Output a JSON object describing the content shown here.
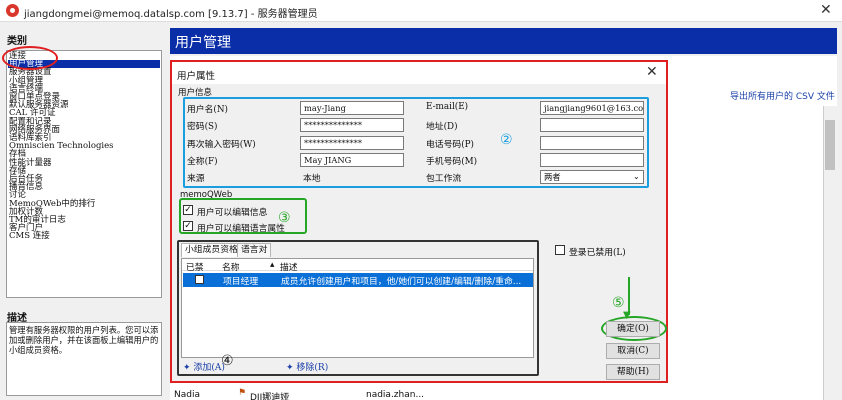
{
  "window": {
    "title": "jiangdongmei@memoq.datalsp.com [9.13.7] - 服务器管理员"
  },
  "left": {
    "category_heading": "类别",
    "categories": [
      "连接",
      "用户管理",
      "服务器设置",
      "小组管理",
      "语言终端",
      "窗口单点登录",
      "默认服务器资源",
      "CAL 许可证",
      "配置和记录",
      "网络服务界面",
      "语料库索引",
      "Omniscien Technologies",
      "存档",
      "性能计量器",
      "存储",
      "后台任务",
      "播音信息",
      "讨论",
      "MemoQWeb中的排行",
      "加权计数",
      "TM的审计日志",
      "客户门户",
      "CMS 连接"
    ],
    "selected_index": 1,
    "description_heading": "描述",
    "description": "管理有服务器权限的用户列表。您可以添加或删除用户，并在该面板上编辑用户的小组成员资格。"
  },
  "main": {
    "title": "用户管理",
    "csv_link": "导出所有用户的 CSV 文件",
    "bg_rows": [
      {
        "name": "Nadia",
        "project": "DJI娜迪娅",
        "email": "nadia.zhan..."
      }
    ]
  },
  "dialog": {
    "title": "用户属性",
    "user_info_legend": "用户信息",
    "fields": {
      "username_label": "用户名(N)",
      "username_value": "may-Jiang",
      "password_label": "密码(S)",
      "password_value": "**************",
      "confirm_label": "再次输入密码(W)",
      "confirm_value": "**************",
      "fullname_label": "全称(F)",
      "fullname_value": "May JIANG",
      "source_label": "来源",
      "source_value": "本地",
      "email_label": "E-mail(E)",
      "email_value": "jiangjiang9601@163.com",
      "address_label": "地址(D)",
      "address_value": "",
      "phone_label": "电话号码(P)",
      "phone_value": "",
      "mobile_label": "手机号码(M)",
      "mobile_value": "",
      "package_label": "包工作流",
      "package_value": "两者"
    },
    "memoqweb_legend": "memoQWeb",
    "checkbox_edit_info": "用户可以编辑信息",
    "checkbox_edit_lang": "用户可以编辑语言属性",
    "tabs": [
      "小组成员资格",
      "语言对"
    ],
    "grid_headers": {
      "disabled": "已禁",
      "name": "名称",
      "desc": "描述"
    },
    "grid_row": {
      "name": "项目经理",
      "desc": "成员允许创建用户和项目，他/她们可以创建/编辑/删除/重命..."
    },
    "add_link": "添加(A)",
    "remove_link": "移除(R)",
    "login_disabled": "登录已禁用(L)",
    "ok": "确定(O)",
    "cancel": "取消(C)",
    "help": "帮助(H)",
    "annotations": {
      "n2": "②",
      "n3": "③",
      "n4": "④",
      "n5": "⑤"
    }
  }
}
